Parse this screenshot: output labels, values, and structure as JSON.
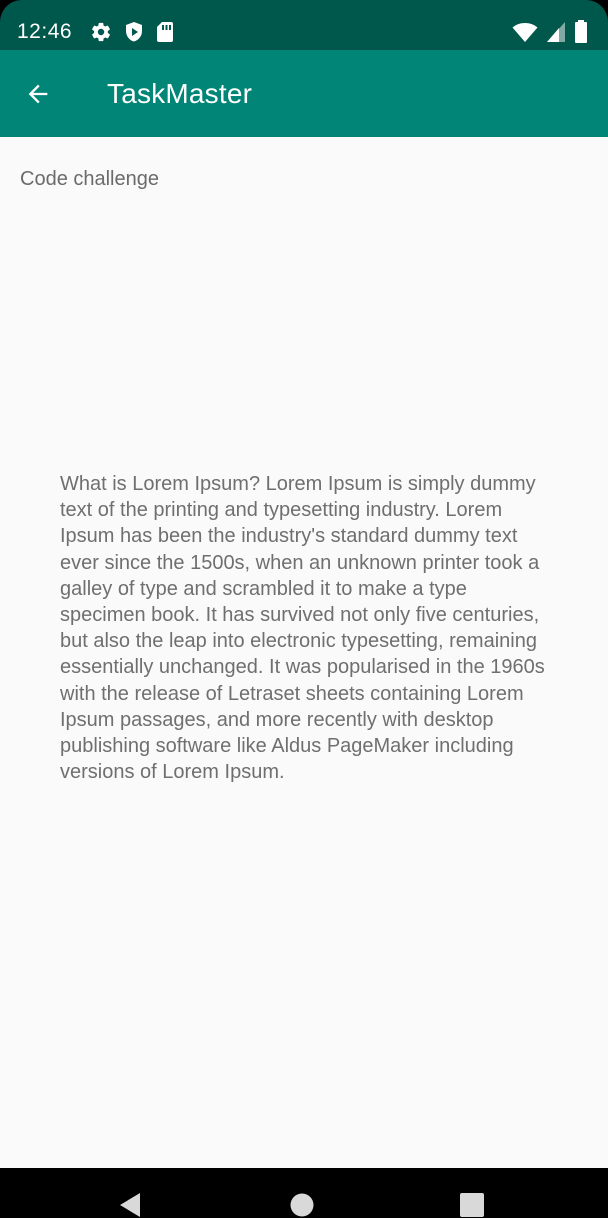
{
  "status_bar": {
    "time": "12:46",
    "left_icons": [
      "settings-icon",
      "shield-play-icon",
      "sd-card-icon"
    ],
    "right_icons": [
      "wifi-icon",
      "cell-signal-icon",
      "battery-icon"
    ],
    "color": "#00574b"
  },
  "app_bar": {
    "title": "TaskMaster",
    "back_icon": "arrow-back-icon",
    "color": "#008577"
  },
  "task": {
    "title": "Code challenge",
    "body": "What is Lorem Ipsum? Lorem Ipsum is simply dummy text of the printing and typesetting industry. Lorem Ipsum has been the industry's standard dummy text ever since the 1500s, when an unknown printer took a galley of type and scrambled it to make a type specimen book. It has survived not only five centuries, but also the leap into electronic typesetting, remaining essentially unchanged. It was popularised in the 1960s with the release of Letraset sheets containing Lorem Ipsum passages, and more recently with desktop publishing software like Aldus PageMaker including versions of Lorem Ipsum."
  },
  "nav_bar": {
    "buttons": [
      "back-triangle-icon",
      "home-circle-icon",
      "recents-square-icon"
    ]
  }
}
